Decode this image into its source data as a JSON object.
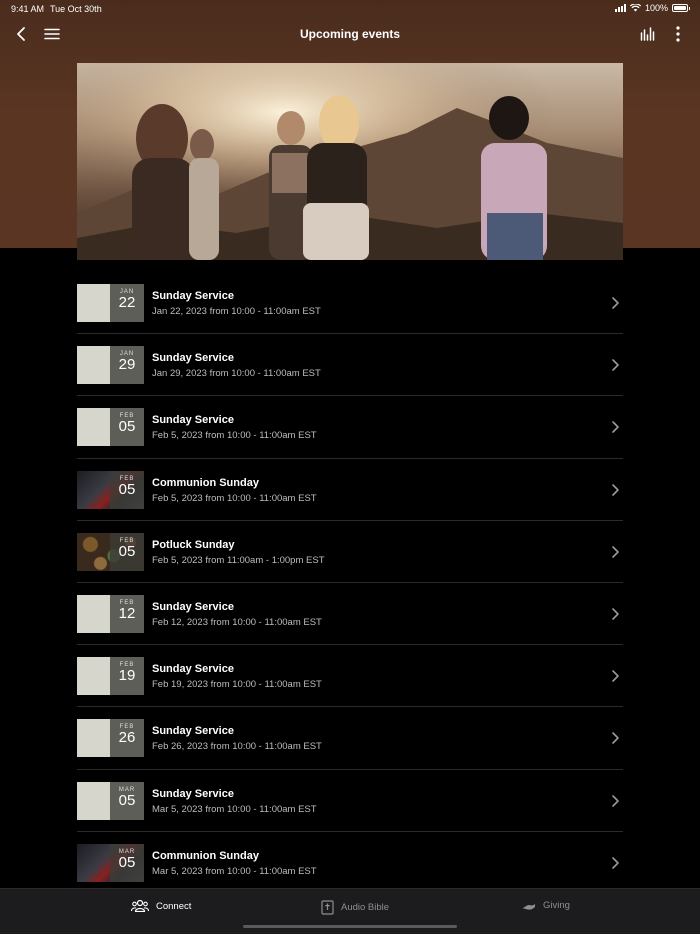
{
  "status": {
    "time": "9:41 AM",
    "date": "Tue Oct 30th",
    "battery": "100%"
  },
  "nav": {
    "title": "Upcoming events"
  },
  "events": [
    {
      "title": "Sunday Service",
      "subtitle": "Jan 22, 2023 from 10:00 - 11:00am EST",
      "month": "JAN",
      "day": "22",
      "thumb": "plain"
    },
    {
      "title": "Sunday Service",
      "subtitle": "Jan 29, 2023 from 10:00 - 11:00am EST",
      "month": "JAN",
      "day": "29",
      "thumb": "plain"
    },
    {
      "title": "Sunday Service",
      "subtitle": "Feb 5, 2023 from 10:00 - 11:00am EST",
      "month": "FEB",
      "day": "05",
      "thumb": "plain"
    },
    {
      "title": "Communion Sunday",
      "subtitle": "Feb 5, 2023 from 10:00 - 11:00am EST",
      "month": "FEB",
      "day": "05",
      "thumb": "dark"
    },
    {
      "title": "Potluck Sunday",
      "subtitle": "Feb 5, 2023 from 11:00am - 1:00pm EST",
      "month": "FEB",
      "day": "05",
      "thumb": "food"
    },
    {
      "title": "Sunday Service",
      "subtitle": "Feb 12, 2023 from 10:00 - 11:00am EST",
      "month": "FEB",
      "day": "12",
      "thumb": "plain"
    },
    {
      "title": "Sunday Service",
      "subtitle": "Feb 19, 2023 from 10:00 - 11:00am EST",
      "month": "FEB",
      "day": "19",
      "thumb": "plain"
    },
    {
      "title": "Sunday Service",
      "subtitle": "Feb 26, 2023 from 10:00 - 11:00am EST",
      "month": "FEB",
      "day": "26",
      "thumb": "plain"
    },
    {
      "title": "Sunday Service",
      "subtitle": "Mar 5, 2023 from 10:00 - 11:00am EST",
      "month": "MAR",
      "day": "05",
      "thumb": "plain"
    },
    {
      "title": "Communion Sunday",
      "subtitle": "Mar 5, 2023 from 10:00 - 11:00am EST",
      "month": "MAR",
      "day": "05",
      "thumb": "dark"
    }
  ],
  "tabs": [
    {
      "label": "Connect",
      "icon": "people-icon",
      "active": true
    },
    {
      "label": "Audio Bible",
      "icon": "bible-icon",
      "active": false
    },
    {
      "label": "Giving",
      "icon": "giving-icon",
      "active": false
    }
  ],
  "colors": {
    "header": "#5a3522",
    "background": "#000000",
    "tabbar": "#1c1c1e"
  }
}
